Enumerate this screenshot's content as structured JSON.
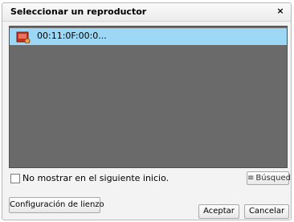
{
  "dialog": {
    "title": "Seleccionar un reproductor",
    "close_glyph": "×"
  },
  "players": [
    {
      "label": "00:11:0F:00:0...",
      "icon": "player-device-icon",
      "selected": true
    }
  ],
  "options": {
    "dont_show_label": "No mostrar en el siguiente inicio.",
    "dont_show_checked": false
  },
  "buttons": {
    "search_label": "Búsqueda",
    "search_icon": "list-icon",
    "canvas_settings_label": "Configuración de lienzo",
    "accept_label": "Aceptar",
    "cancel_label": "Cancelar"
  },
  "colors": {
    "selection": "#9cd7f6",
    "list_background": "#6a6a6a",
    "icon_red": "#c4321c"
  }
}
